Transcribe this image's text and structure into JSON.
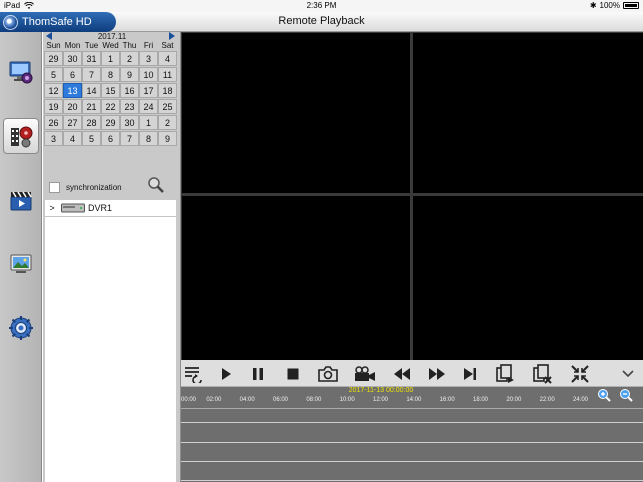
{
  "statusbar": {
    "device": "iPad",
    "time": "2:36 PM",
    "battery": "100%"
  },
  "app": {
    "brand": "ThomSafe HD",
    "title": "Remote Playback"
  },
  "sidebar": {
    "items": [
      {
        "name": "live-view",
        "icon": "monitor-camera-icon"
      },
      {
        "name": "remote-playback",
        "icon": "film-reel-icon",
        "active": true
      },
      {
        "name": "local-playback",
        "icon": "clapperboard-icon"
      },
      {
        "name": "image-manager",
        "icon": "picture-screen-icon"
      },
      {
        "name": "settings",
        "icon": "gear-wheel-icon"
      }
    ]
  },
  "calendar": {
    "month": "2017.11",
    "weekdays": [
      "Sun",
      "Mon",
      "Tue",
      "Wed",
      "Thu",
      "Fri",
      "Sat"
    ],
    "weeks": [
      [
        "29",
        "30",
        "31",
        "1",
        "2",
        "3",
        "4"
      ],
      [
        "5",
        "6",
        "7",
        "8",
        "9",
        "10",
        "11"
      ],
      [
        "12",
        "13",
        "14",
        "15",
        "16",
        "17",
        "18"
      ],
      [
        "19",
        "20",
        "21",
        "22",
        "23",
        "24",
        "25"
      ],
      [
        "26",
        "27",
        "28",
        "29",
        "30",
        "1",
        "2"
      ],
      [
        "3",
        "4",
        "5",
        "6",
        "7",
        "8",
        "9"
      ]
    ],
    "selected": "13"
  },
  "sync": {
    "label": "synchronization"
  },
  "devices": [
    {
      "name": "DVR1"
    }
  ],
  "toolbar": {
    "buttons": [
      "playlist-icon",
      "play-icon",
      "pause-icon",
      "stop-icon",
      "snapshot-icon",
      "record-icon",
      "rewind-icon",
      "fast-forward-icon",
      "step-forward-icon",
      "copy-clip-icon",
      "delete-clip-icon",
      "fullscreen-icon",
      "more-chevron-icon"
    ]
  },
  "timeline": {
    "current": "2017-11-13 00:00:00",
    "hours": [
      "00:00",
      "02:00",
      "04:00",
      "06:00",
      "08:00",
      "10:00",
      "12:00",
      "14:00",
      "16:00",
      "18:00",
      "20:00",
      "22:00",
      "24:00"
    ]
  },
  "colors": {
    "accent": "#2e7bdc",
    "brand": "#0e3c7c",
    "timeline_date": "#f2e600"
  }
}
